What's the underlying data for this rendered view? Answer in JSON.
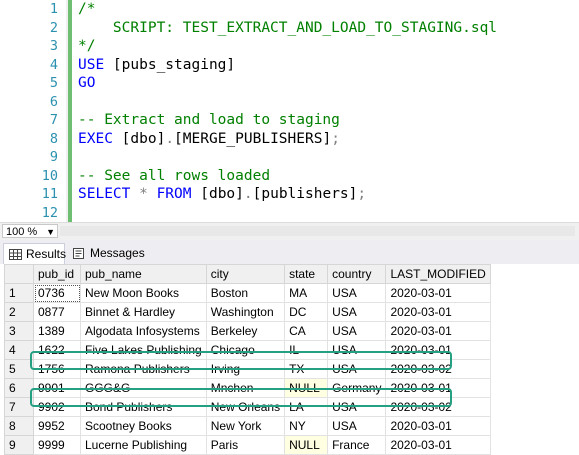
{
  "editor": {
    "lines": [
      {
        "n": "1",
        "parts": [
          {
            "t": "/*",
            "c": "cm"
          }
        ]
      },
      {
        "n": "2",
        "parts": [
          {
            "t": "    SCRIPT: TEST_EXTRACT_AND_LOAD_TO_STAGING.sql",
            "c": "cm"
          }
        ]
      },
      {
        "n": "3",
        "parts": [
          {
            "t": "*/",
            "c": "cm"
          }
        ]
      },
      {
        "n": "4",
        "parts": [
          {
            "t": "USE ",
            "c": "kw"
          },
          {
            "t": "[pubs_staging]",
            "c": "bk"
          }
        ]
      },
      {
        "n": "5",
        "parts": [
          {
            "t": "GO",
            "c": "kw"
          }
        ]
      },
      {
        "n": "6",
        "parts": []
      },
      {
        "n": "7",
        "parts": [
          {
            "t": "-- Extract and load to staging",
            "c": "cm"
          }
        ]
      },
      {
        "n": "8",
        "parts": [
          {
            "t": "EXEC ",
            "c": "kw"
          },
          {
            "t": "[dbo]",
            "c": "bk"
          },
          {
            "t": ".",
            "c": "gr"
          },
          {
            "t": "[MERGE_PUBLISHERS]",
            "c": "bk"
          },
          {
            "t": ";",
            "c": "gr"
          }
        ]
      },
      {
        "n": "9",
        "parts": []
      },
      {
        "n": "10",
        "parts": [
          {
            "t": "-- See all rows loaded",
            "c": "cm"
          }
        ]
      },
      {
        "n": "11",
        "parts": [
          {
            "t": "SELECT ",
            "c": "kw"
          },
          {
            "t": "* ",
            "c": "gr"
          },
          {
            "t": "FROM ",
            "c": "kw"
          },
          {
            "t": "[dbo]",
            "c": "bk"
          },
          {
            "t": ".",
            "c": "gr"
          },
          {
            "t": "[publishers]",
            "c": "bk"
          },
          {
            "t": ";",
            "c": "gr"
          }
        ]
      },
      {
        "n": "12",
        "parts": []
      }
    ]
  },
  "zoom": {
    "value": "100 %"
  },
  "tabs": {
    "results": "Results",
    "messages": "Messages"
  },
  "grid": {
    "columns": [
      "pub_id",
      "pub_name",
      "city",
      "state",
      "country",
      "LAST_MODIFIED"
    ],
    "rows": [
      [
        "1",
        "0736",
        "New Moon Books",
        "Boston",
        "MA",
        "USA",
        "2020-03-01"
      ],
      [
        "2",
        "0877",
        "Binnet & Hardley",
        "Washington",
        "DC",
        "USA",
        "2020-03-01"
      ],
      [
        "3",
        "1389",
        "Algodata Infosystems",
        "Berkeley",
        "CA",
        "USA",
        "2020-03-01"
      ],
      [
        "4",
        "1622",
        "Five Lakes Publishing",
        "Chicago",
        "IL",
        "USA",
        "2020-03-01"
      ],
      [
        "5",
        "1756",
        "Ramona Publishers",
        "Irving",
        "TX",
        "USA",
        "2020-03-02"
      ],
      [
        "6",
        "9901",
        "GGG&G",
        "Mnchen",
        "NULL",
        "Germany",
        "2020-03-01"
      ],
      [
        "7",
        "9902",
        "Bond Publishers",
        "New Orleans",
        "LA",
        "USA",
        "2020-03-02"
      ],
      [
        "8",
        "9952",
        "Scootney Books",
        "New York",
        "NY",
        "USA",
        "2020-03-01"
      ],
      [
        "9",
        "9999",
        "Lucerne Publishing",
        "Paris",
        "NULL",
        "France",
        "2020-03-01"
      ]
    ]
  },
  "colors": {
    "highlight": "#26a082",
    "keyword": "#0000ff",
    "comment": "#008000",
    "line_number": "#2b91af",
    "null_cell": "#ffffe1"
  }
}
